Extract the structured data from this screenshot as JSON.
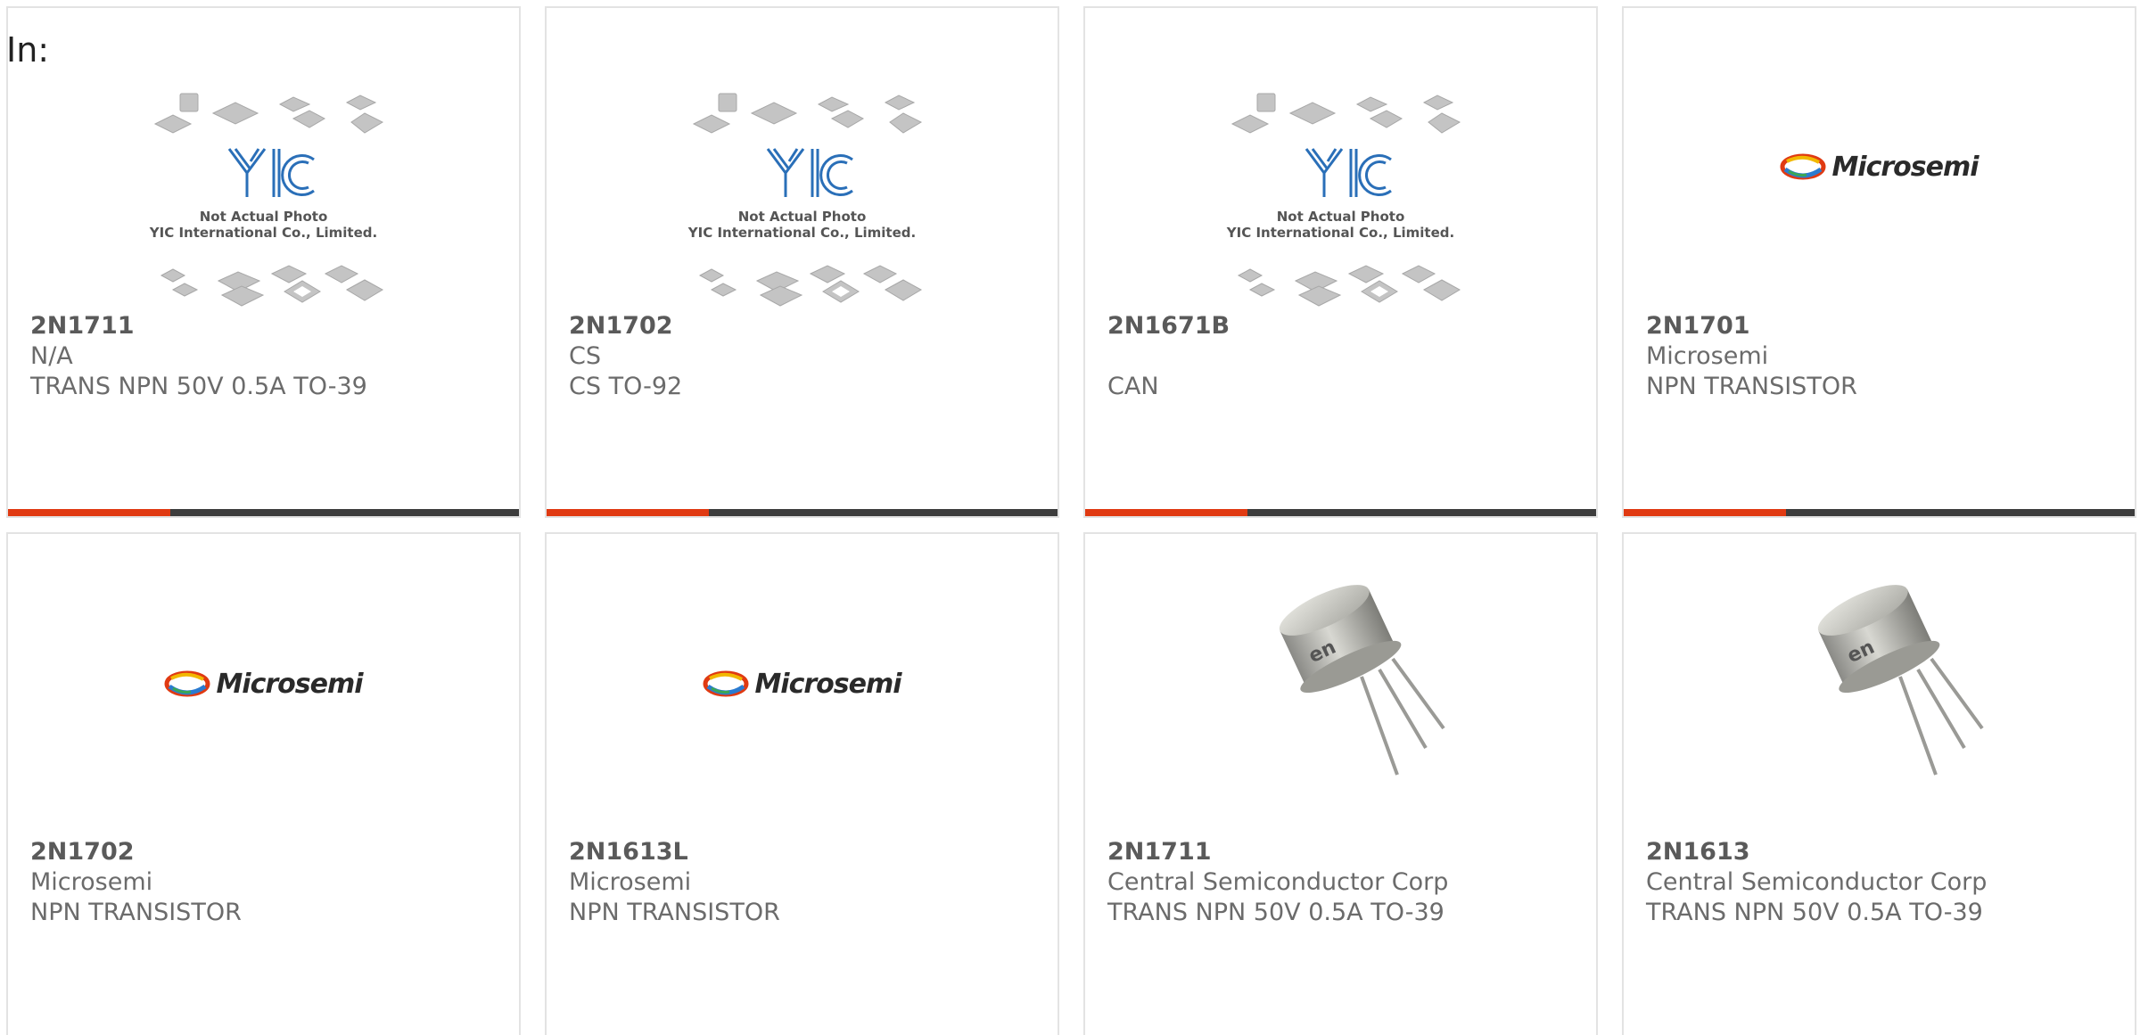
{
  "filter": {
    "label": "In:"
  },
  "placeholder": {
    "line1": "Not Actual Photo",
    "line2": "YIC International Co., Limited."
  },
  "brand": {
    "microsemi": "Microsemi"
  },
  "colors": {
    "accent": "#e03a12",
    "bar": "#3d3d3d"
  },
  "products": [
    {
      "part": "2N1711",
      "manufacturer": "N/A",
      "description": "TRANS NPN 50V 0.5A TO-39",
      "image": "yic-placeholder"
    },
    {
      "part": "2N1702",
      "manufacturer": "CS",
      "description": "CS TO-92",
      "image": "yic-placeholder"
    },
    {
      "part": "2N1671B",
      "manufacturer": "",
      "description": "CAN",
      "image": "yic-placeholder"
    },
    {
      "part": "2N1701",
      "manufacturer": "Microsemi",
      "description": "NPN TRANSISTOR",
      "image": "microsemi-logo"
    },
    {
      "part": "2N1702",
      "manufacturer": "Microsemi",
      "description": "NPN TRANSISTOR",
      "image": "microsemi-logo"
    },
    {
      "part": "2N1613L",
      "manufacturer": "Microsemi",
      "description": "NPN TRANSISTOR",
      "image": "microsemi-logo"
    },
    {
      "part": "2N1711",
      "manufacturer": "Central Semiconductor Corp",
      "description": "TRANS NPN 50V 0.5A TO-39",
      "image": "to39-transistor-photo"
    },
    {
      "part": "2N1613",
      "manufacturer": "Central Semiconductor Corp",
      "description": "TRANS NPN 50V 0.5A TO-39",
      "image": "to39-transistor-photo"
    }
  ]
}
